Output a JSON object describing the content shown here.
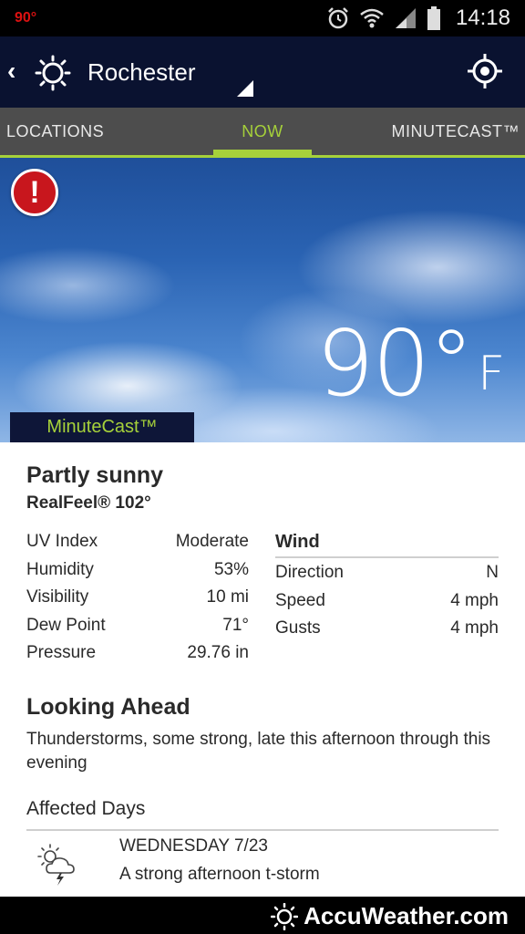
{
  "status_bar": {
    "temp": "90°",
    "time": "14:18",
    "icons": [
      "alarm-clock-icon",
      "wifi-icon",
      "signal-icon",
      "battery-icon"
    ]
  },
  "header": {
    "city": "Rochester",
    "icons": [
      "back-chevron-icon",
      "sun-icon",
      "dropdown-triangle-icon",
      "locate-icon"
    ]
  },
  "tabs": [
    {
      "label": "LOCATIONS"
    },
    {
      "label": "NOW",
      "active": true
    },
    {
      "label": "MINUTECAST™"
    }
  ],
  "hero": {
    "temperature": "90°",
    "unit": "F",
    "minutecast_label": "MinuteCast™"
  },
  "current": {
    "condition": "Partly sunny",
    "realfeel": "RealFeel® 102°",
    "stats": [
      {
        "label": "UV Index",
        "value": "Moderate"
      },
      {
        "label": "Humidity",
        "value": "53%"
      },
      {
        "label": "Visibility",
        "value": "10 mi"
      },
      {
        "label": "Dew Point",
        "value": "71°"
      },
      {
        "label": "Pressure",
        "value": "29.76 in"
      }
    ],
    "wind": {
      "title": "Wind",
      "rows": [
        {
          "label": "Direction",
          "value": "N"
        },
        {
          "label": "Speed",
          "value": "4 mph"
        },
        {
          "label": "Gusts",
          "value": "4 mph"
        }
      ]
    }
  },
  "looking_ahead": {
    "title": "Looking Ahead",
    "text": "Thunderstorms, some strong, late this afternoon through this evening"
  },
  "affected_days": {
    "title": "Affected Days",
    "days": [
      {
        "date": "WEDNESDAY 7/23",
        "description": "A strong afternoon t-storm",
        "icon": "thunderstorm-sun-icon"
      }
    ]
  },
  "footer": {
    "brand": "AccuWeather.com"
  },
  "colors": {
    "accent": "#a6d13a",
    "alert": "#c8161d",
    "header_bg": "#0a1230",
    "tab_bg": "#4d4d4d"
  }
}
